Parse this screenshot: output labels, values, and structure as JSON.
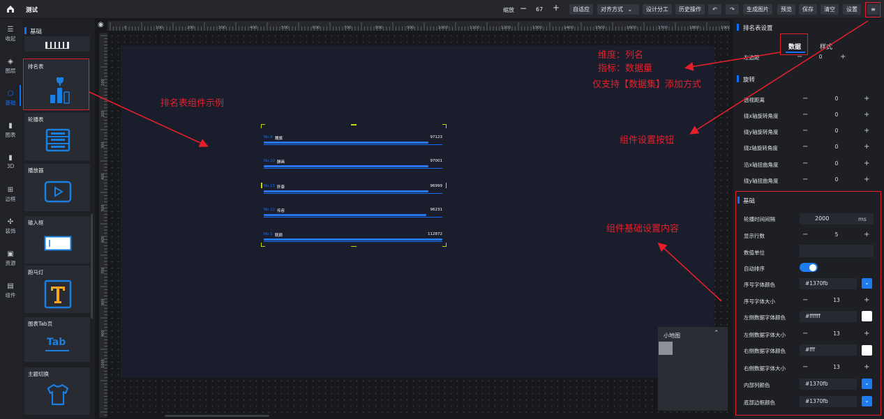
{
  "app": {
    "title": "测试"
  },
  "toolbar": {
    "zoom_label": "缩放",
    "zoom_value": "67",
    "fit_label": "自适应",
    "align_label": "对齐方式",
    "design_split_label": "设计分工",
    "history_label": "历史操作",
    "generate_image_label": "生成图片",
    "preview_label": "预览",
    "save_label": "保存",
    "clear_label": "清空",
    "settings_label": "设置"
  },
  "leftnav": {
    "items": [
      {
        "label": "收起",
        "icon": "collapse-icon"
      },
      {
        "label": "图层",
        "icon": "layers-icon"
      },
      {
        "label": "基础",
        "icon": "basic-icon"
      },
      {
        "label": "图表",
        "icon": "chart-icon"
      },
      {
        "label": "3D",
        "icon": "3d-icon"
      },
      {
        "label": "边框",
        "icon": "border-icon"
      },
      {
        "label": "装饰",
        "icon": "decoration-icon"
      },
      {
        "label": "资源",
        "icon": "resource-icon"
      },
      {
        "label": "组件",
        "icon": "component-icon"
      }
    ]
  },
  "palette": {
    "section_title": "基础",
    "cards": [
      {
        "title": "排名表"
      },
      {
        "title": "轮播表"
      },
      {
        "title": "播放器"
      },
      {
        "title": "输入框"
      },
      {
        "title": "跑马灯"
      },
      {
        "title": "图表Tab页",
        "icon_text": "Tab"
      },
      {
        "title": "主题切换"
      }
    ]
  },
  "ruler": {
    "ticks": [
      "0",
      "100",
      "200",
      "300",
      "400",
      "500",
      "600",
      "700",
      "800",
      "900",
      "1000",
      "1100",
      "1200",
      "1300",
      "1400",
      "1500",
      "1600",
      "1700",
      "1800",
      "1900"
    ],
    "vticks": [
      "100",
      "200",
      "300",
      "400",
      "500",
      "600",
      "700",
      "800",
      "900",
      "1000"
    ]
  },
  "ranking": {
    "rows": [
      {
        "no": "No.9",
        "name": "魏旗",
        "value": "97123",
        "fill": 0.92
      },
      {
        "no": "No.10",
        "name": "酬画",
        "value": "97001",
        "fill": 0.92
      },
      {
        "no": "No.11",
        "name": "肝康",
        "value": "96999",
        "fill": 0.92
      },
      {
        "no": "No.12",
        "name": "传容",
        "value": "96231",
        "fill": 0.91
      },
      {
        "no": "No.1",
        "name": "联颜",
        "value": "112872",
        "fill": 1.0
      }
    ]
  },
  "minimap": {
    "title": "小地图"
  },
  "rightpanel": {
    "title": "排名表设置",
    "tabs": [
      "数据",
      "样式"
    ],
    "left_margin_label": "左边距",
    "left_margin_value": "0",
    "rotate_title": "旋转",
    "rotate_rows": [
      {
        "label": "透视距离",
        "value": "0"
      },
      {
        "label": "绕x轴旋转角度",
        "value": "0"
      },
      {
        "label": "绕y轴旋转角度",
        "value": "0"
      },
      {
        "label": "绕z轴旋转角度",
        "value": "0"
      },
      {
        "label": "沿x轴扭曲角度",
        "value": "0"
      },
      {
        "label": "绕y轴扭曲角度",
        "value": "0"
      }
    ],
    "basic_title": "基础",
    "interval_label": "轮播时间间隔",
    "interval_value": "2000",
    "interval_unit": "ms",
    "rows_label": "显示行数",
    "rows_value": "5",
    "unit_label": "数值单位",
    "unit_value": "",
    "autosort_label": "自动排序",
    "autosort_on": true,
    "index_color_label": "序号字体颜色",
    "index_color_value": "#1370fb",
    "index_size_label": "序号字体大小",
    "index_size_value": "13",
    "left_color_label": "左侧数据字体颜色",
    "left_color_value": "#ffffff",
    "left_size_label": "左侧数据字体大小",
    "left_size_value": "13",
    "right_color_label": "右侧数据字体颜色",
    "right_color_value": "#fff",
    "right_size_label": "右侧数据字体大小",
    "right_size_value": "13",
    "inner_color_label": "内部列颜色",
    "inner_color_value": "#1370fb",
    "bottom_color_label": "底部边框颜色",
    "bottom_color_value": "#1370fb"
  },
  "annotations": {
    "example": "排名表组件示例",
    "dimension": "维度：列名",
    "metric": "指标：数据量",
    "only_dataset": "仅支持【数据集】添加方式",
    "settings_button": "组件设置按钮",
    "basic_settings": "组件基础设置内容"
  },
  "colors": {
    "accent": "#1370fb",
    "annotation": "#e5202b",
    "panel": "#1d1f24",
    "canvas": "#1a1e2c"
  }
}
